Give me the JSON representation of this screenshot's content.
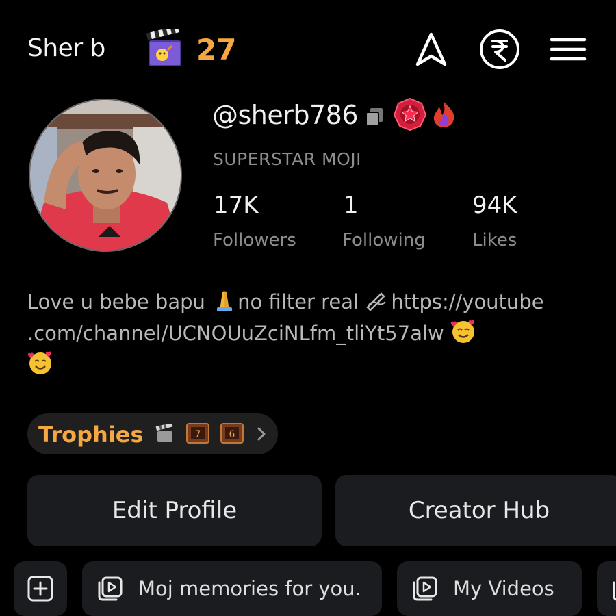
{
  "header": {
    "display_name": "Sher b",
    "streak_count": "27"
  },
  "profile": {
    "handle": "@sherb786",
    "level": "SUPERSTAR MOJI",
    "stats": [
      {
        "value": "17K",
        "label": "Followers"
      },
      {
        "value": "1",
        "label": "Following"
      },
      {
        "value": "94K",
        "label": "Likes"
      }
    ],
    "bio": {
      "line1_a": "Love u bebe bapu ",
      "line1_b": "no filter real ",
      "line1_c": "https://youtube",
      "line2": ".com/channel/UCNOUuZciNLfm_tliYt57alw "
    }
  },
  "trophies": {
    "label": "Trophies",
    "badge_7": "7",
    "badge_6": "6"
  },
  "buttons": {
    "edit_profile": "Edit Profile",
    "creator_hub": "Creator Hub"
  },
  "chips": {
    "memories": "Moj memories for you.",
    "my_videos": "My Videos"
  },
  "colors": {
    "accent_orange": "#f5a742",
    "background": "#000000",
    "card": "#1b1c20",
    "muted_text": "#8c8c8c"
  },
  "icons": [
    "clapperboard-icon",
    "navigation-arrow-icon",
    "rupee-icon",
    "hamburger-menu-icon",
    "copy-icon",
    "star-badge-icon",
    "fire-badge-icon",
    "folded-hands-icon",
    "writing-hand-icon",
    "smiling-hearts-emoji-icon",
    "chevron-right-icon",
    "add-square-icon",
    "video-play-icon"
  ]
}
